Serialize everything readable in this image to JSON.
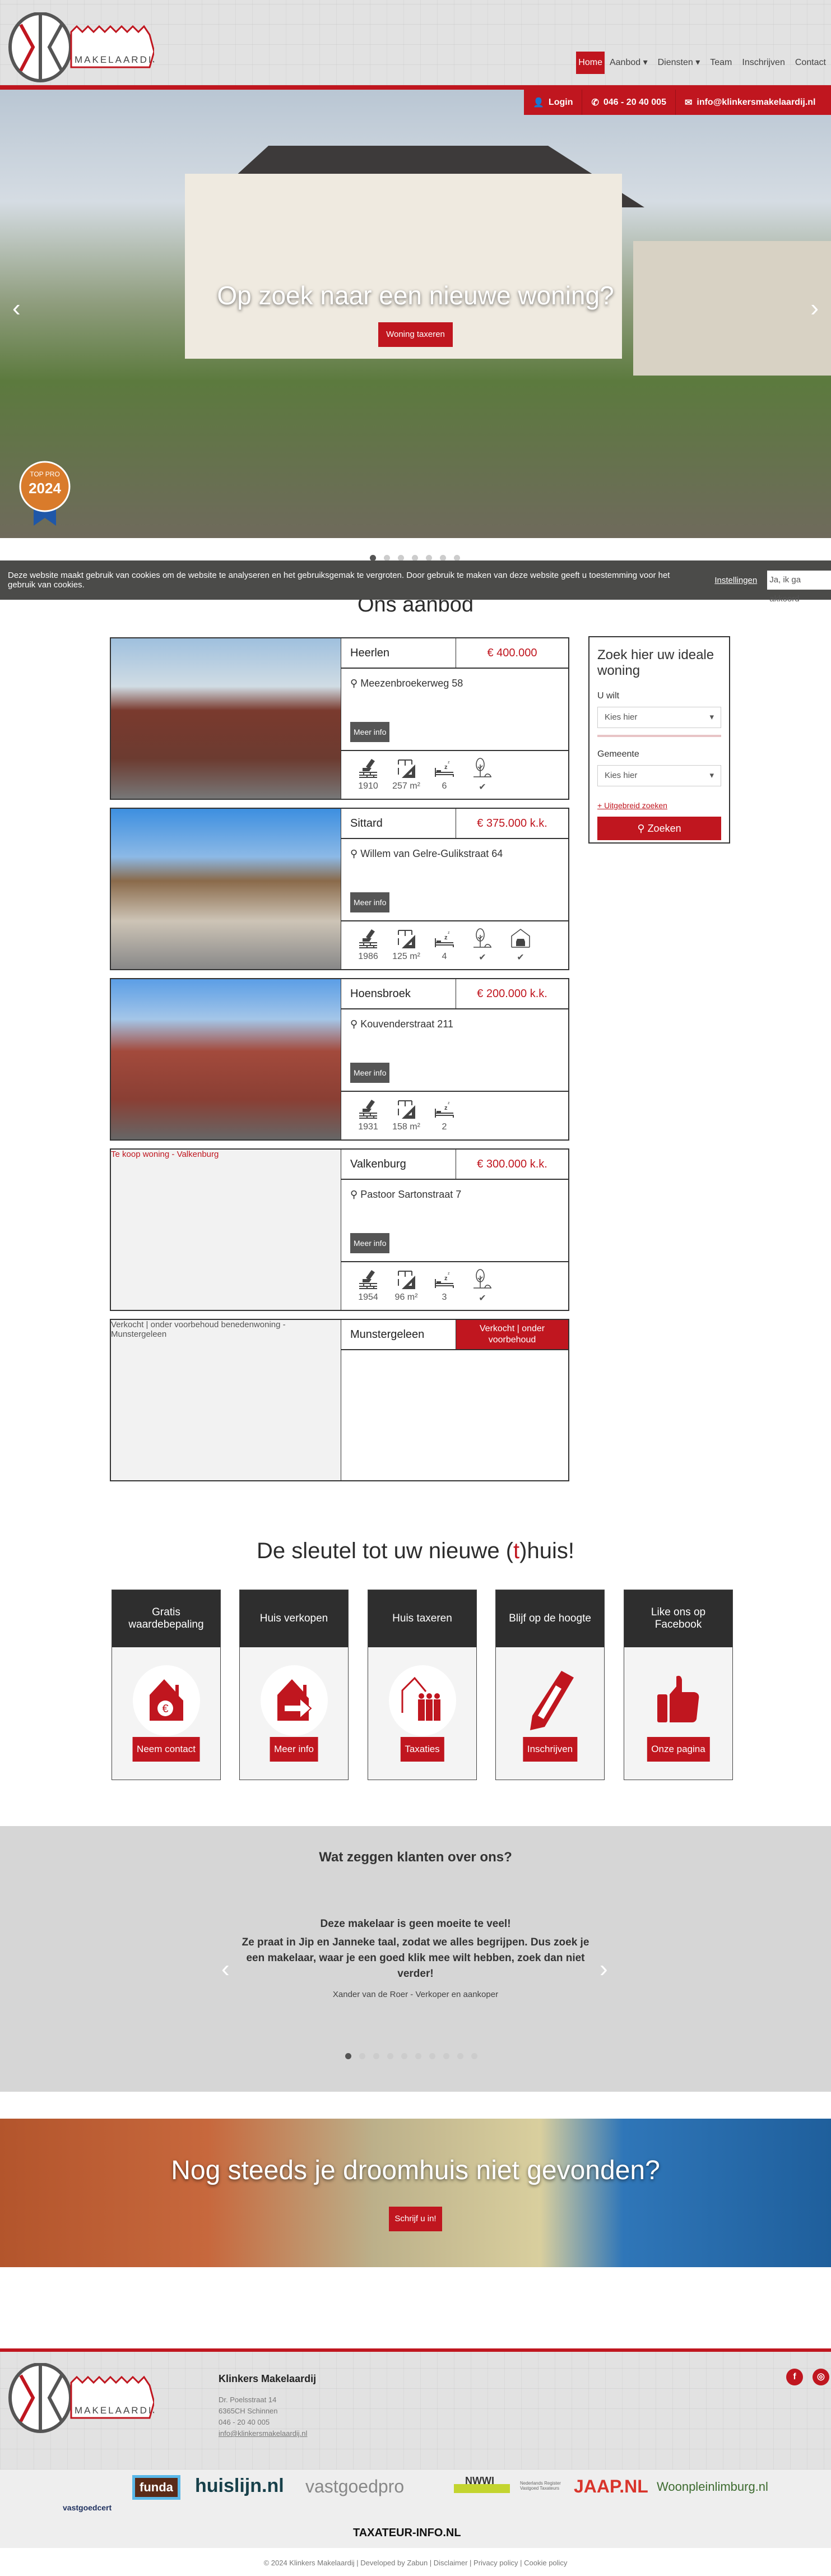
{
  "brand": {
    "name": "Klinkers Makelaardij",
    "logo_text": "MAKELAARDIJ",
    "accent": "#c0161f"
  },
  "nav": {
    "items": [
      {
        "label": "Home",
        "active": true
      },
      {
        "label": "Aanbod ▾"
      },
      {
        "label": "Diensten ▾"
      },
      {
        "label": "Team"
      },
      {
        "label": "Inschrijven"
      },
      {
        "label": "Contact"
      }
    ]
  },
  "contactbar": {
    "login": "Login",
    "phone": "046 - 20 40 005",
    "email": "info@klinkersmakelaardij.nl"
  },
  "hero": {
    "title": "Op zoek naar een nieuwe woning?",
    "button": "Woning taxeren",
    "badge_text": "TOP PRO 2024",
    "slides": 7,
    "active_slide": 1
  },
  "cookie": {
    "text": "Deze website maakt gebruik van cookies om de website te analyseren en het gebruiksgemak te vergroten. Door gebruik te maken van deze website geeft u toestemming voor het gebruik van cookies.",
    "settings": "Instellingen",
    "accept": "Ja, ik ga akkoord"
  },
  "aanbod": {
    "title": "Ons aanbod",
    "more_label": "Meer info",
    "listings": [
      {
        "city": "Heerlen",
        "price": "€ 400.000",
        "address": "Meezenbroekerweg 58",
        "year": "1910",
        "area": "257 m²",
        "rooms": "6",
        "garden": "✔",
        "image": "photo"
      },
      {
        "city": "Sittard",
        "price": "€ 375.000 k.k.",
        "address": "Willem van Gelre-Gulikstraat 64",
        "year": "1986",
        "area": "125 m²",
        "rooms": "4",
        "garden": "✔",
        "garage": "✔",
        "image": "photo"
      },
      {
        "city": "Hoensbroek",
        "price": "€ 200.000 k.k.",
        "address": "Kouvenderstraat 211",
        "year": "1931",
        "area": "158 m²",
        "rooms": "2",
        "image": "photo"
      },
      {
        "city": "Valkenburg",
        "price": "€ 300.000 k.k.",
        "address": "Pastoor Sartonstraat 7",
        "year": "1954",
        "area": "96 m²",
        "rooms": "3",
        "garden": "✔",
        "image_alt": "Te koop woning - Valkenburg"
      },
      {
        "city": "Munstergeleen",
        "price": "Verkocht | onder voorbehoud",
        "sold": true,
        "image_alt": "Verkocht | onder voorbehoud benedenwoning - Munstergeleen"
      }
    ]
  },
  "search": {
    "title": "Zoek hier uw ideale woning",
    "uwilt_label": "U wilt",
    "uwilt_value": "Kies hier",
    "gemeente_label": "Gemeente",
    "gemeente_value": "Kies hier",
    "advanced": "+ Uitgebreid zoeken",
    "button": "Zoeken"
  },
  "services": {
    "title_pre": "De sleutel tot uw nieuwe (",
    "title_accent": "t",
    "title_post": ")huis!",
    "cards": [
      {
        "title": "Gratis waardebepaling",
        "button": "Neem contact",
        "icon": "house-euro-icon"
      },
      {
        "title": "Huis verkopen",
        "button": "Meer info",
        "icon": "house-arrow-icon"
      },
      {
        "title": "Huis taxeren",
        "button": "Taxaties",
        "icon": "house-people-icon"
      },
      {
        "title": "Blijf op de hoogte",
        "button": "Inschrijven",
        "icon": "pencil-icon"
      },
      {
        "title": "Like ons op Facebook",
        "button": "Onze pagina",
        "icon": "thumbs-up-icon"
      }
    ]
  },
  "testimonials": {
    "title": "Wat zeggen klanten over ons?",
    "quote_line1": "Deze makelaar is geen moeite te veel!",
    "quote_line2": "Ze praat in Jip en Janneke taal, zodat we alles begrijpen. Dus zoek je een makelaar, waar je een goed klik mee wilt hebben, zoek dan niet verder!",
    "author": "Xander van de Roer - Verkoper en aankoper",
    "slides": 10,
    "active_slide": 1
  },
  "banner": {
    "title": "Nog steeds je droomhuis niet gevonden?",
    "button": "Schrijf u in!"
  },
  "footer": {
    "company": "Klinkers Makelaardij",
    "street": "Dr. Poelsstraat 14",
    "city": "6365CH Schinnen",
    "phone": "046 - 20 40 005",
    "email": "info@klinkersmakelaardij.nl",
    "partners": [
      "vastgoedcert",
      "funda",
      "huislijn.nl",
      "vastgoedpro",
      "NWWI",
      "Nederlands Register Vastgoed Taxateurs",
      "JAAP.NL",
      "Woonpleinlimburg.nl",
      "TAXATEUR-INFO.NL"
    ],
    "copyright": "© 2024 Klinkers Makelaardij | Developed by Zabun | Disclaimer | Privacy policy | Cookie policy"
  }
}
